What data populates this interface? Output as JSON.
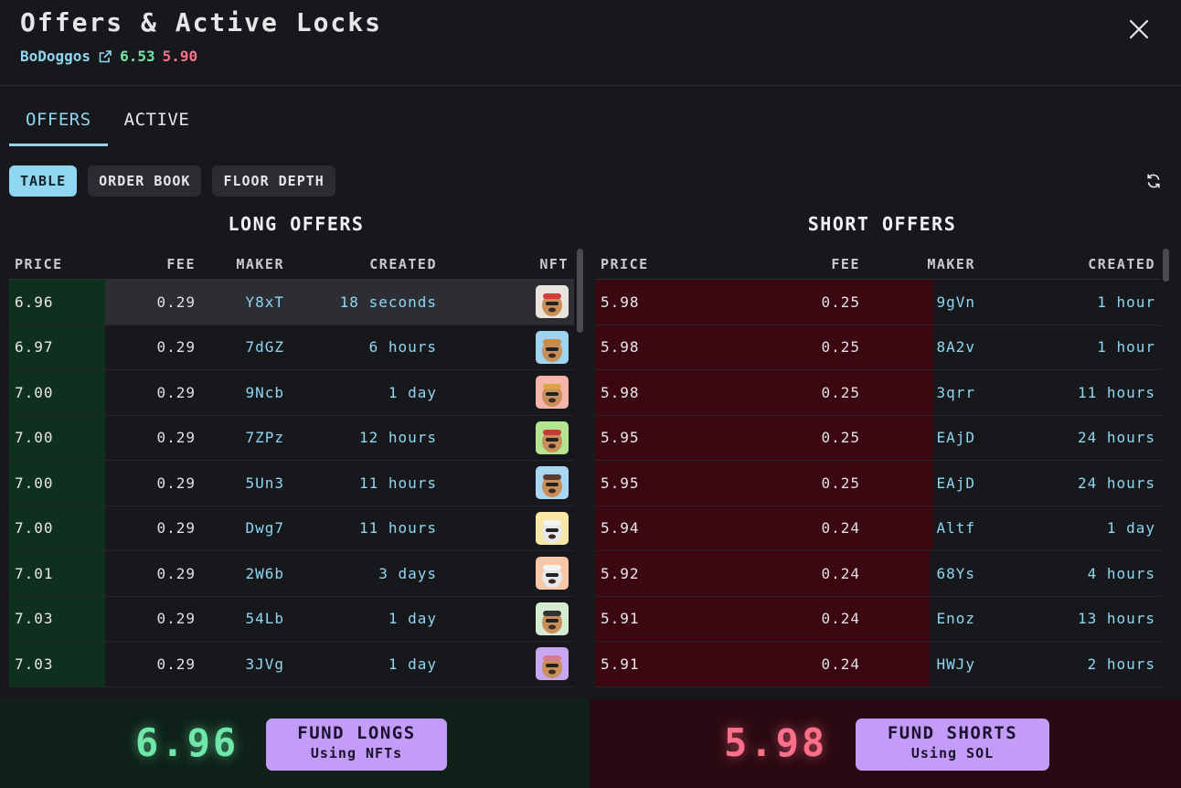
{
  "header": {
    "title": "Offers & Active Locks",
    "collection": "BoDoggos",
    "long_price": "6.53",
    "short_price": "5.90"
  },
  "tabs": [
    {
      "label": "OFFERS",
      "active": true
    },
    {
      "label": "ACTIVE",
      "active": false
    }
  ],
  "views": [
    {
      "label": "TABLE",
      "active": true
    },
    {
      "label": "ORDER BOOK",
      "active": false
    },
    {
      "label": "FLOOR DEPTH",
      "active": false
    }
  ],
  "long_offers": {
    "title": "LONG OFFERS",
    "columns": [
      "PRICE",
      "FEE",
      "MAKER",
      "CREATED",
      "NFT"
    ],
    "rows": [
      {
        "price": "6.96",
        "fee": "0.29",
        "maker": "Y8xT",
        "created": "18 seconds",
        "nft_color": "#e9e4dc",
        "accent": "#d23b3b"
      },
      {
        "price": "6.97",
        "fee": "0.29",
        "maker": "7dGZ",
        "created": "6 hours",
        "nft_color": "#9fd3f0",
        "accent": "#c88b45"
      },
      {
        "price": "7.00",
        "fee": "0.29",
        "maker": "9Ncb",
        "created": "1 day",
        "nft_color": "#f6b5a9",
        "accent": "#d9a441"
      },
      {
        "price": "7.00",
        "fee": "0.29",
        "maker": "7ZPz",
        "created": "12 hours",
        "nft_color": "#b5e38f",
        "accent": "#c43a3a"
      },
      {
        "price": "7.00",
        "fee": "0.29",
        "maker": "5Un3",
        "created": "11 hours",
        "nft_color": "#a9d7f2",
        "accent": "#5a3b2e"
      },
      {
        "price": "7.00",
        "fee": "0.29",
        "maker": "Dwg7",
        "created": "11 hours",
        "nft_color": "#f7e6a6",
        "accent": "#f2f2f2"
      },
      {
        "price": "7.01",
        "fee": "0.29",
        "maker": "2W6b",
        "created": "3 days",
        "nft_color": "#f8c7a9",
        "accent": "#f2f2f2"
      },
      {
        "price": "7.03",
        "fee": "0.29",
        "maker": "54Lb",
        "created": "1 day",
        "nft_color": "#d6ecd2",
        "accent": "#333333"
      },
      {
        "price": "7.03",
        "fee": "0.29",
        "maker": "3JVg",
        "created": "1 day",
        "nft_color": "#c7a7ef",
        "accent": "#d97a8c"
      }
    ]
  },
  "short_offers": {
    "title": "SHORT OFFERS",
    "columns": [
      "PRICE",
      "FEE",
      "MAKER",
      "CREATED"
    ],
    "rows": [
      {
        "price": "5.98",
        "fee": "0.25",
        "maker": "9gVn",
        "created": "1 hour"
      },
      {
        "price": "5.98",
        "fee": "0.25",
        "maker": "8A2v",
        "created": "1 hour"
      },
      {
        "price": "5.98",
        "fee": "0.25",
        "maker": "3qrr",
        "created": "11 hours"
      },
      {
        "price": "5.95",
        "fee": "0.25",
        "maker": "EAjD",
        "created": "24 hours"
      },
      {
        "price": "5.95",
        "fee": "0.25",
        "maker": "EAjD",
        "created": "24 hours"
      },
      {
        "price": "5.94",
        "fee": "0.24",
        "maker": "Altf",
        "created": "1 day"
      },
      {
        "price": "5.92",
        "fee": "0.24",
        "maker": "68Ys",
        "created": "4 hours"
      },
      {
        "price": "5.91",
        "fee": "0.24",
        "maker": "Enoz",
        "created": "13 hours"
      },
      {
        "price": "5.91",
        "fee": "0.24",
        "maker": "HWJy",
        "created": "2 hours"
      }
    ]
  },
  "footer": {
    "long_price": "6.96",
    "fund_longs": "FUND LONGS",
    "fund_longs_sub": "Using NFTs",
    "short_price": "5.98",
    "fund_shorts": "FUND SHORTS",
    "fund_shorts_sub": "Using SOL"
  },
  "colors": {
    "accent": "#8fd6f0",
    "long": "#6ee7a8",
    "short": "#ff6f8a",
    "long_bar": "#10301f",
    "short_bar": "#3b0812",
    "fund_button": "#c39cf7"
  }
}
